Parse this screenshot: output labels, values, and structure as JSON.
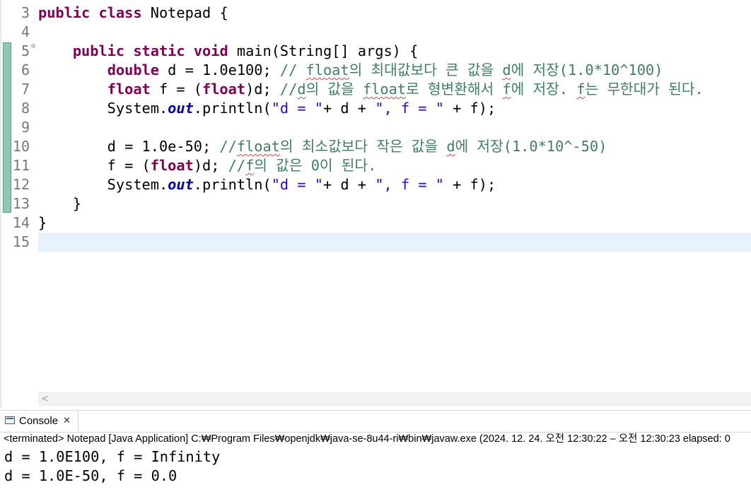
{
  "editor": {
    "line_numbers": [
      "3",
      "4",
      "5",
      "6",
      "7",
      "8",
      "9",
      "10",
      "11",
      "12",
      "13",
      "14",
      "15"
    ],
    "lines": [
      {
        "segments": [
          {
            "t": "public",
            "c": "kw"
          },
          {
            "t": " "
          },
          {
            "t": "class",
            "c": "kw"
          },
          {
            "t": " Notepad {"
          }
        ]
      },
      {
        "segments": []
      },
      {
        "segments": [
          {
            "t": "    "
          },
          {
            "t": "public",
            "c": "kw"
          },
          {
            "t": " "
          },
          {
            "t": "static",
            "c": "kw"
          },
          {
            "t": " "
          },
          {
            "t": "void",
            "c": "kw"
          },
          {
            "t": " main(String[] args) {"
          }
        ]
      },
      {
        "segments": [
          {
            "t": "        "
          },
          {
            "t": "double",
            "c": "kw"
          },
          {
            "t": " d = 1.0e100; "
          },
          {
            "t": "// ",
            "c": "cm"
          },
          {
            "t": "float",
            "c": "cm sq"
          },
          {
            "t": "의 최대값보다 큰 값을 ",
            "c": "cm"
          },
          {
            "t": "d",
            "c": "cm sq"
          },
          {
            "t": "에 저장(1.0*10^100)",
            "c": "cm"
          }
        ]
      },
      {
        "segments": [
          {
            "t": "        "
          },
          {
            "t": "float",
            "c": "kw"
          },
          {
            "t": " f = ("
          },
          {
            "t": "float",
            "c": "kw"
          },
          {
            "t": ")d; "
          },
          {
            "t": "//",
            "c": "cm"
          },
          {
            "t": "d",
            "c": "cm sq"
          },
          {
            "t": "의 값을 ",
            "c": "cm"
          },
          {
            "t": "float",
            "c": "cm sq"
          },
          {
            "t": "로 형변환해서 ",
            "c": "cm"
          },
          {
            "t": "f",
            "c": "cm sq"
          },
          {
            "t": "에 저장. ",
            "c": "cm"
          },
          {
            "t": "f",
            "c": "cm sq"
          },
          {
            "t": "는 무한대가 된다.",
            "c": "cm"
          }
        ]
      },
      {
        "segments": [
          {
            "t": "        System."
          },
          {
            "t": "out",
            "c": "fld"
          },
          {
            "t": ".println("
          },
          {
            "t": "\"d = \"",
            "c": "str"
          },
          {
            "t": "+ d + "
          },
          {
            "t": "\", f = \"",
            "c": "str"
          },
          {
            "t": " + f);"
          }
        ]
      },
      {
        "segments": []
      },
      {
        "segments": [
          {
            "t": "        d = 1.0e-50; "
          },
          {
            "t": "//",
            "c": "cm"
          },
          {
            "t": "float",
            "c": "cm sq"
          },
          {
            "t": "의 최소값보다 작은 값을 ",
            "c": "cm"
          },
          {
            "t": "d",
            "c": "cm sq"
          },
          {
            "t": "에 저장(1.0*10^-50)",
            "c": "cm"
          }
        ]
      },
      {
        "segments": [
          {
            "t": "        f = ("
          },
          {
            "t": "float",
            "c": "kw"
          },
          {
            "t": ")d; "
          },
          {
            "t": "//",
            "c": "cm"
          },
          {
            "t": "f",
            "c": "cm sq"
          },
          {
            "t": "의 값은 0이 된다.",
            "c": "cm"
          }
        ]
      },
      {
        "segments": [
          {
            "t": "        System."
          },
          {
            "t": "out",
            "c": "fld"
          },
          {
            "t": ".println("
          },
          {
            "t": "\"d = \"",
            "c": "str"
          },
          {
            "t": "+ d + "
          },
          {
            "t": "\", f = \"",
            "c": "str"
          },
          {
            "t": " + f);"
          }
        ]
      },
      {
        "segments": [
          {
            "t": "    }"
          }
        ]
      },
      {
        "segments": [
          {
            "t": "}"
          }
        ]
      },
      {
        "segments": []
      }
    ],
    "current_line_index": 12,
    "fold_marker_line_index": 2,
    "fold_marker_glyph": "⊖"
  },
  "colors": {
    "keyword": "#7f0055",
    "comment": "#3f7f5f",
    "string": "#2a00ff",
    "static_field": "#0000c0",
    "current_line": "#e8f2fe",
    "change_bar": "#8fc7b6"
  },
  "hscroll": {
    "arrow": "<"
  },
  "console": {
    "tab_title": "Console",
    "close_glyph": "✕",
    "status": "<terminated> Notepad [Java Application] C:₩Program Files₩openjdk₩java-se-8u44-ri₩bin₩javaw.exe  (2024. 12. 24. 오전 12:30:22 – 오전 12:30:23 elapsed: 0",
    "output": [
      "d = 1.0E100, f = Infinity",
      "d = 1.0E-50, f = 0.0"
    ]
  }
}
